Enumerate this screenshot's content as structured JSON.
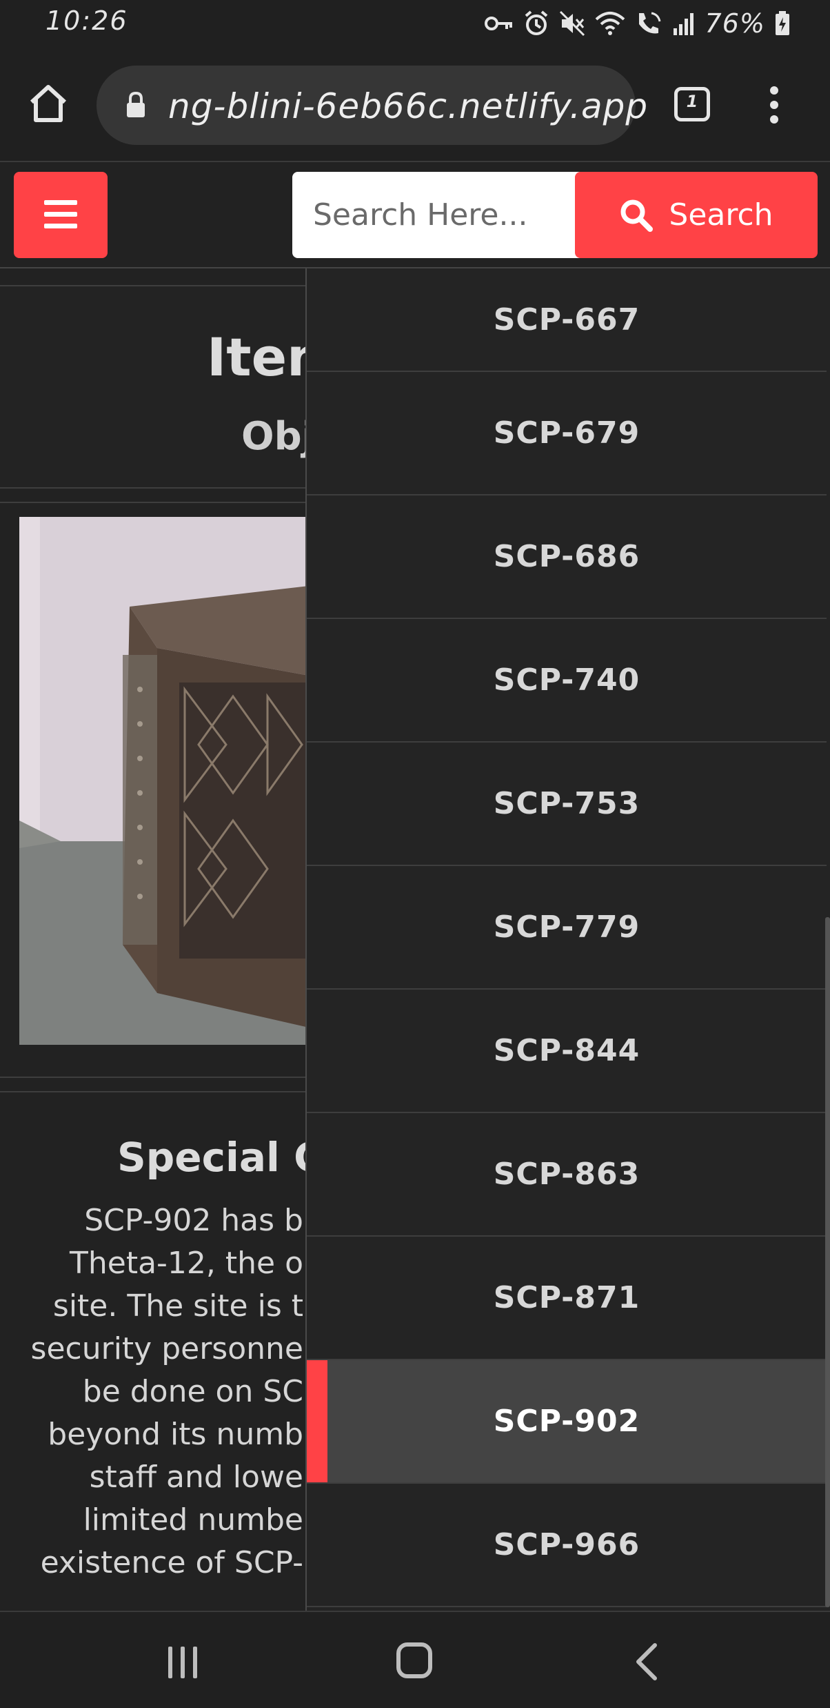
{
  "status_bar": {
    "time": "10:26",
    "battery": "76%",
    "icons": [
      "key-icon",
      "alarm-icon",
      "mute-icon",
      "wifi-icon",
      "wifi-calling-icon",
      "signal-icon",
      "battery-icon"
    ]
  },
  "browser": {
    "url": "ng-blini-6eb66c.netlify.app",
    "tab_count": "1"
  },
  "header": {
    "search_placeholder": "Search Here...",
    "search_button_label": "Search",
    "accent_color": "#ff4246"
  },
  "page": {
    "item_title": "Item",
    "object_class": "Obj",
    "containment_heading": "Special Co",
    "containment_lines": [
      "SCP-902 has b",
      "Theta-12, the o",
      "site. The site is t",
      "security personne",
      "be done on SC",
      "beyond its numb",
      "staff and lowe",
      "limited numbe",
      "existence of SCP-"
    ]
  },
  "sidebar": {
    "items": [
      {
        "label": "SCP-667",
        "active": false
      },
      {
        "label": "SCP-679",
        "active": false
      },
      {
        "label": "SCP-686",
        "active": false
      },
      {
        "label": "SCP-740",
        "active": false
      },
      {
        "label": "SCP-753",
        "active": false
      },
      {
        "label": "SCP-779",
        "active": false
      },
      {
        "label": "SCP-844",
        "active": false
      },
      {
        "label": "SCP-863",
        "active": false
      },
      {
        "label": "SCP-871",
        "active": false
      },
      {
        "label": "SCP-902",
        "active": true
      },
      {
        "label": "SCP-966",
        "active": false
      }
    ]
  }
}
